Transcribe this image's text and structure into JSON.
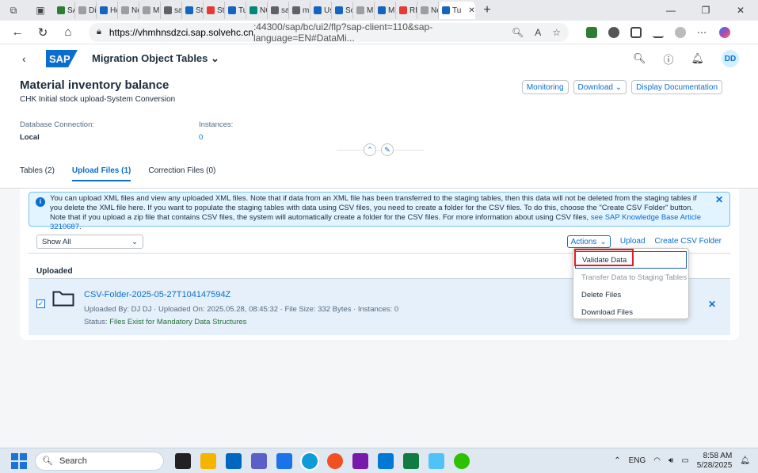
{
  "browser": {
    "tabs": [
      "SA",
      "Dis",
      "Hc",
      "Ne",
      "Mi",
      "sa",
      "Ste",
      "Ste",
      "Tu",
      "NC",
      "sa",
      "mi",
      "Us",
      "So",
      "Mi",
      "Mi",
      "RE",
      "Ne",
      "Tu"
    ],
    "tab_colors": [
      "#2e7d32",
      "#9e9e9e",
      "#1565c0",
      "#9e9e9e",
      "#9e9e9e",
      "#5f6368",
      "#1565c0",
      "#e53935",
      "#1565c0",
      "#00897b",
      "#5f6368",
      "#5f6368",
      "#1565c0",
      "#1565c0",
      "#9e9e9e",
      "#1565c0",
      "#e53935",
      "#9e9e9e",
      "#1565c0"
    ],
    "url_host": "https://vhmhnsdzci.sap.solvehc.cn",
    "url_rest": ":44300/sap/bc/ui2/flp?sap-client=110&sap-language=EN#DataMi..."
  },
  "shell": {
    "logo": "SAP",
    "title": "Migration Object Tables",
    "avatar": "DD"
  },
  "header": {
    "title": "Material inventory balance",
    "subtitle": "CHK Initial stock upload-System Conversion",
    "buttons": {
      "monitoring": "Monitoring",
      "download": "Download",
      "display_doc": "Display Documentation"
    },
    "db_label": "Database Connection:",
    "db_value": "Local",
    "inst_label": "Instances:",
    "inst_value": "0"
  },
  "tabs": [
    "Tables (2)",
    "Upload Files (1)",
    "Correction Files (0)"
  ],
  "info": {
    "text": "You can upload XML files and view any uploaded XML files. Note that if data from an XML file has been transferred to the staging tables, then this data will not be deleted from the staging tables if you delete the XML file here. If you want to populate the staging tables with data using CSV files, you need to create a folder for the CSV files. To do this, choose the \"Create CSV Folder\" button. Note that if you upload a zip file that contains CSV files, the system will automatically create a folder for the CSV files. For more information about using CSV files, ",
    "link": "see SAP Knowledge Base Article 3210687",
    "tail": "."
  },
  "toolbar": {
    "filter": "Show All",
    "actions": "Actions",
    "upload": "Upload",
    "create_folder": "Create CSV Folder"
  },
  "section": "Uploaded",
  "file": {
    "name": "CSV-Folder-2025-05-27T104147594Z",
    "meta": "Uploaded By: DJ DJ · Uploaded On: 2025.05.28, 08:45:32 · File Size: 332 Bytes · Instances: 0",
    "status_label": "Status: ",
    "status_value": "Files Exist for Mandatory Data Structures"
  },
  "menu": {
    "items": [
      "Validate Data",
      "Transfer Data to Staging Tables",
      "Delete Files",
      "Download Files"
    ]
  },
  "taskbar": {
    "search": "Search",
    "lang": "ENG",
    "time": "8:58 AM",
    "date": "5/28/2025"
  }
}
